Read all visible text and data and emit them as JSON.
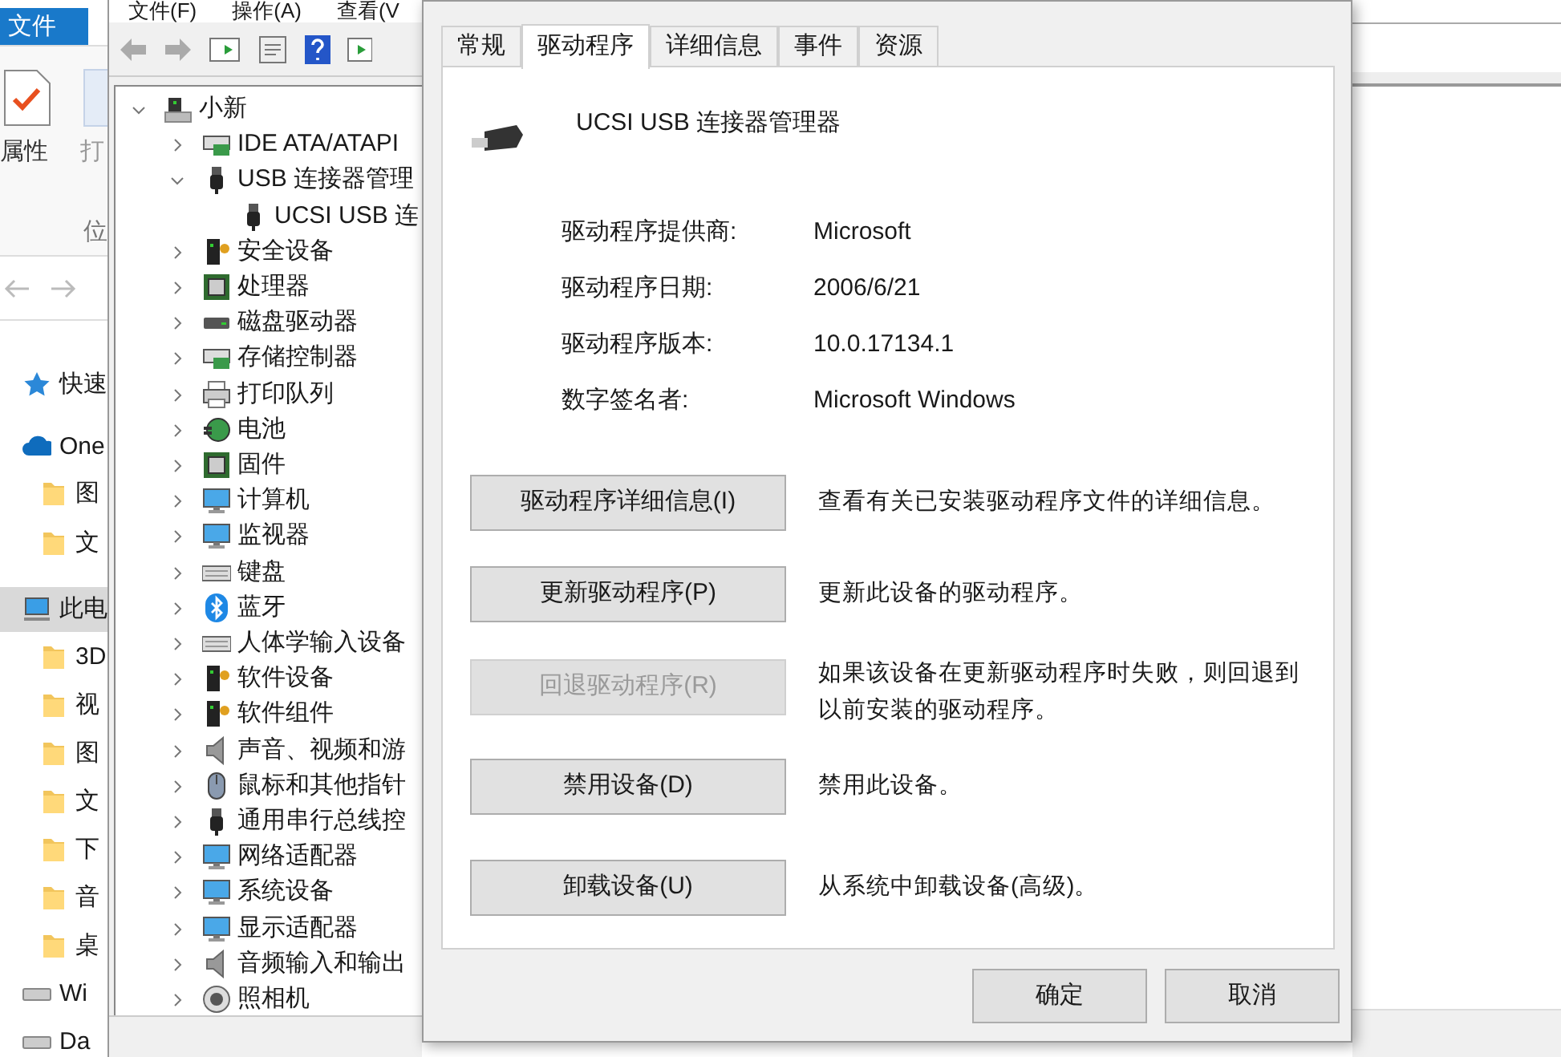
{
  "explorer": {
    "ribbon_tab": "文件",
    "ribbon_buttons": [
      "属性",
      "打"
    ],
    "group_label": "位",
    "nav": [
      {
        "label": "快速",
        "kind": "star",
        "selected": false
      },
      {
        "label": "One",
        "kind": "cloud",
        "selected": false
      },
      {
        "label": "图",
        "kind": "folder",
        "selected": false
      },
      {
        "label": "文",
        "kind": "folder",
        "selected": false
      },
      {
        "label": "此电",
        "kind": "pc",
        "selected": true
      },
      {
        "label": "3D",
        "kind": "folder",
        "selected": false
      },
      {
        "label": "视",
        "kind": "folder",
        "selected": false
      },
      {
        "label": "图",
        "kind": "folder",
        "selected": false
      },
      {
        "label": "文",
        "kind": "folder",
        "selected": false
      },
      {
        "label": "下",
        "kind": "folder",
        "selected": false
      },
      {
        "label": "音",
        "kind": "folder",
        "selected": false
      },
      {
        "label": "桌",
        "kind": "folder",
        "selected": false
      },
      {
        "label": "Wi",
        "kind": "drive",
        "selected": false
      },
      {
        "label": "Da",
        "kind": "drive",
        "selected": false
      }
    ]
  },
  "device_manager": {
    "menu": [
      "文件(F)",
      "操作(A)",
      "查看(V"
    ],
    "tree": {
      "label": "小新",
      "kind": "computer",
      "expanded": true,
      "children": [
        {
          "label": "IDE ATA/ATAPI",
          "kind": "board",
          "expanded": false
        },
        {
          "label": "USB 连接器管理",
          "kind": "usb",
          "expanded": true,
          "children": [
            {
              "label": "UCSI USB 连",
              "kind": "usb"
            }
          ]
        },
        {
          "label": "安全设备",
          "kind": "tower",
          "expanded": false
        },
        {
          "label": "处理器",
          "kind": "chip",
          "expanded": false
        },
        {
          "label": "磁盘驱动器",
          "kind": "drive",
          "expanded": false
        },
        {
          "label": "存储控制器",
          "kind": "board",
          "expanded": false
        },
        {
          "label": "打印队列",
          "kind": "printer",
          "expanded": false
        },
        {
          "label": "电池",
          "kind": "battery",
          "expanded": false
        },
        {
          "label": "固件",
          "kind": "chip",
          "expanded": false
        },
        {
          "label": "计算机",
          "kind": "monitor",
          "expanded": false
        },
        {
          "label": "监视器",
          "kind": "monitor",
          "expanded": false
        },
        {
          "label": "键盘",
          "kind": "keyboard",
          "expanded": false
        },
        {
          "label": "蓝牙",
          "kind": "bluetooth",
          "expanded": false
        },
        {
          "label": "人体学输入设备",
          "kind": "keyboard",
          "expanded": false
        },
        {
          "label": "软件设备",
          "kind": "tower",
          "expanded": false
        },
        {
          "label": "软件组件",
          "kind": "tower",
          "expanded": false
        },
        {
          "label": "声音、视频和游",
          "kind": "speaker",
          "expanded": false
        },
        {
          "label": "鼠标和其他指针",
          "kind": "mouse",
          "expanded": false
        },
        {
          "label": "通用串行总线控",
          "kind": "usb",
          "expanded": false
        },
        {
          "label": "网络适配器",
          "kind": "monitor",
          "expanded": false
        },
        {
          "label": "系统设备",
          "kind": "monitor",
          "expanded": false
        },
        {
          "label": "显示适配器",
          "kind": "monitor",
          "expanded": false
        },
        {
          "label": "音频输入和输出",
          "kind": "speaker",
          "expanded": false
        },
        {
          "label": "照相机",
          "kind": "camera",
          "expanded": false
        }
      ]
    }
  },
  "dialog": {
    "tabs": [
      {
        "label": "常规",
        "selected": false
      },
      {
        "label": "驱动程序",
        "selected": true
      },
      {
        "label": "详细信息",
        "selected": false
      },
      {
        "label": "事件",
        "selected": false
      },
      {
        "label": "资源",
        "selected": false
      }
    ],
    "device_name": "UCSI USB 连接器管理器",
    "fields": [
      {
        "label": "驱动程序提供商:",
        "value": "Microsoft"
      },
      {
        "label": "驱动程序日期:",
        "value": "2006/6/21"
      },
      {
        "label": "驱动程序版本:",
        "value": "10.0.17134.1"
      },
      {
        "label": "数字签名者:",
        "value": "Microsoft Windows"
      }
    ],
    "actions": [
      {
        "button": "驱动程序详细信息(I)",
        "description": "查看有关已安装驱动程序文件的详细信息。",
        "disabled": false
      },
      {
        "button": "更新驱动程序(P)",
        "description": "更新此设备的驱动程序。",
        "disabled": false
      },
      {
        "button": "回退驱动程序(R)",
        "description": "如果该设备在更新驱动程序时失败，则回退到以前安装的驱动程序。",
        "disabled": true
      },
      {
        "button": "禁用设备(D)",
        "description": "禁用此设备。",
        "disabled": false
      },
      {
        "button": "卸载设备(U)",
        "description": "从系统中卸载设备(高级)。",
        "disabled": false
      }
    ],
    "buttons": [
      "确定",
      "取消"
    ]
  }
}
